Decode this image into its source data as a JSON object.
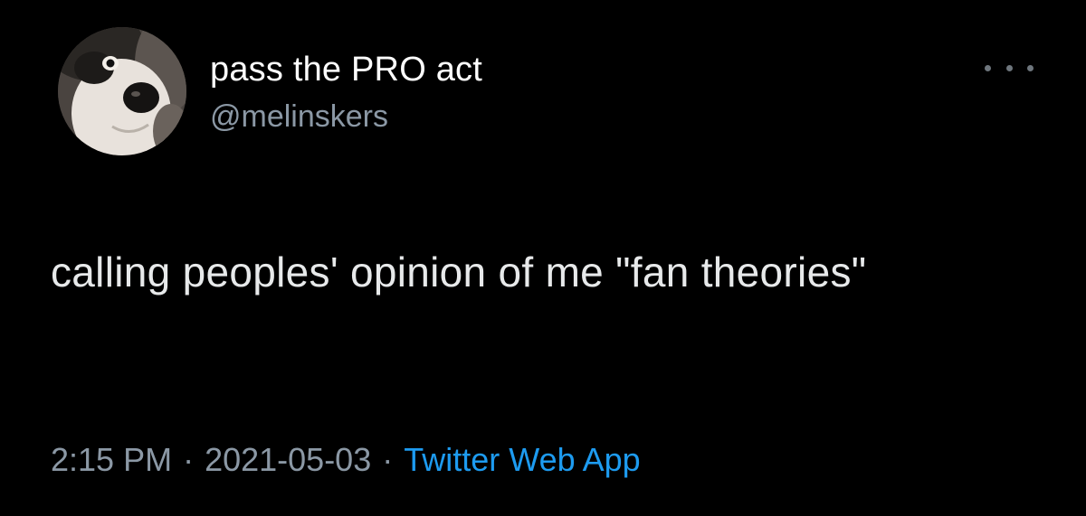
{
  "author": {
    "display_name": "pass the PRO act",
    "handle": "@melinskers",
    "avatar_icon": "dog-avatar-icon"
  },
  "menu": {
    "icon": "more-options-icon"
  },
  "tweet": {
    "text": "calling peoples' opinion of me \"fan theories\""
  },
  "meta": {
    "time": "2:15 PM",
    "separator": "·",
    "date": "2021-05-03",
    "source": "Twitter Web App"
  },
  "colors": {
    "background": "#000000",
    "primary_text": "#e7e9ea",
    "secondary_text": "#8b98a5",
    "link": "#1d9bf0"
  }
}
